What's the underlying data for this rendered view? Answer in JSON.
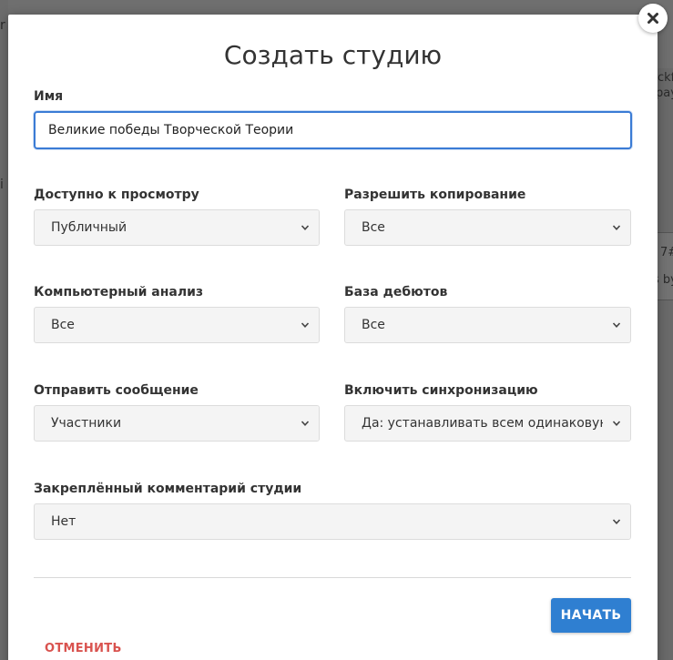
{
  "background": {
    "right_fragments": [
      "ockfi",
      "pay",
      "S",
      "7#",
      "s by"
    ],
    "left_fragments": [
      "r",
      "i"
    ]
  },
  "dialog": {
    "title": "Создать студию",
    "close_label": "×",
    "name_field": {
      "label": "Имя",
      "value": "Великие победы Творческой Теории"
    },
    "visibility": {
      "label": "Доступно к просмотру",
      "value": "Публичный"
    },
    "copying": {
      "label": "Разрешить копирование",
      "value": "Все"
    },
    "computer_analysis": {
      "label": "Компьютерный анализ",
      "value": "Все"
    },
    "opening_db": {
      "label": "База дебютов",
      "value": "Все"
    },
    "send_message": {
      "label": "Отправить сообщение",
      "value": "Участники"
    },
    "sync": {
      "label": "Включить синхронизацию",
      "value": "Да: устанавливать всем одинаковую позицию"
    },
    "pinned_comment": {
      "label": "Закреплённый комментарий студии",
      "value": "Нет"
    },
    "start_button": "НАЧАТЬ",
    "cancel_link": "ОТМЕНИТЬ"
  },
  "colors": {
    "primary": "#2f7fd1",
    "cancel": "#d9534f",
    "focus_border": "#3a7bd5"
  }
}
